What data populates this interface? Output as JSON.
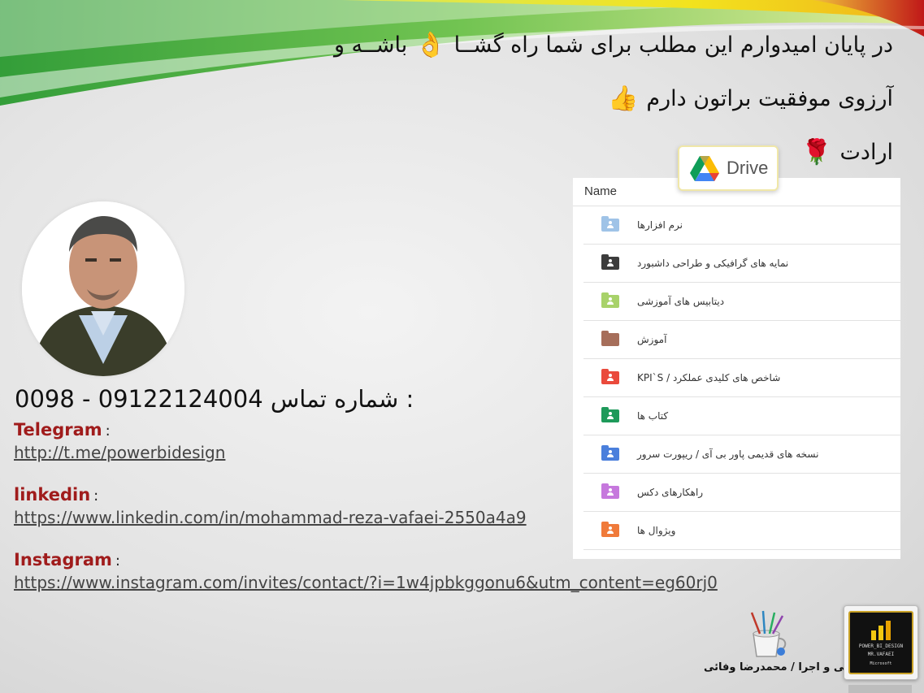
{
  "message": {
    "line1": "در پایان امیدوارم این مطلب برای شما راه گشــا",
    "line1_end": "باشــه و",
    "line1_emoji": "👌",
    "line2": "آرزوی موفقیت براتون دارم",
    "line2_emoji": "👍",
    "line3": "ارادت",
    "line3_emoji": "🌹"
  },
  "contact": {
    "phone_label": "شماره تماس :",
    "phone_number": "0098 - 09122124004",
    "telegram_label": "Telegram",
    "telegram_url": "http://t.me/powerbidesign",
    "linkedin_label": "linkedin",
    "linkedin_url": "https://www.linkedin.com/in/mohammad-reza-vafaei-2550a4a9",
    "instagram_label": "Instagram",
    "instagram_url": "https://www.instagram.com/invites/contact/?i=1w4jpbkggonu6&utm_content=eg60rj0",
    "colon": ":"
  },
  "drive": {
    "badge_label": "Drive",
    "column_header": "Name",
    "folders": [
      {
        "label": "نرم افزارها",
        "color": "#9fc3e7",
        "shared": true
      },
      {
        "label": "نمایه های گرافیکی و طراحی داشبورد",
        "color": "#3c3c3c",
        "shared": true
      },
      {
        "label": "دیتابیس های آموزشی",
        "color": "#a8d26a",
        "shared": true
      },
      {
        "label": "آموزش",
        "color": "#a66e5a",
        "shared": false
      },
      {
        "label": "شاخص های کلیدی عملکرد / KPI`S",
        "color": "#ea4a3c",
        "shared": true
      },
      {
        "label": "کتاب ها",
        "color": "#1e9a5a",
        "shared": true
      },
      {
        "label": "نسخه های قدیمی پاور بی آی / ریپورت سرور",
        "color": "#4a7fdc",
        "shared": true
      },
      {
        "label": "راهکارهای دکس",
        "color": "#c678dd",
        "shared": true
      },
      {
        "label": "ویژوال ها",
        "color": "#f07a3a",
        "shared": true
      }
    ]
  },
  "footer": {
    "credit": "طراحی و اجرا / محمدرضا وفائی",
    "logo_line1": "POWER_BI_DESIGN",
    "logo_line2": "MR.VAFAEI",
    "logo_line3": "Microsoft"
  },
  "colors": {
    "accent_red": "#a01c1c",
    "swoosh_green": "#3aa635",
    "swoosh_yellow": "#e8d21c",
    "swoosh_red": "#c8201e"
  }
}
